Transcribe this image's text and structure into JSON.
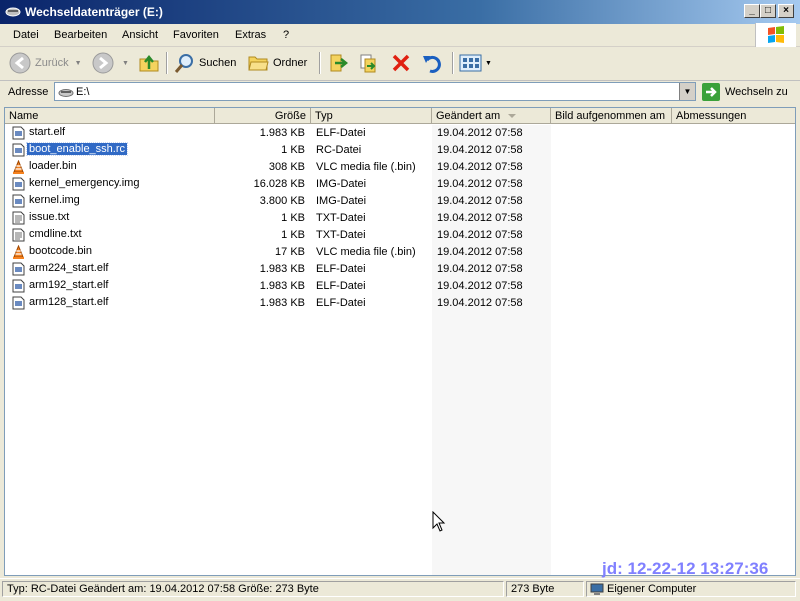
{
  "window": {
    "title": "Wechseldatenträger (E:)"
  },
  "menu": {
    "items": [
      "Datei",
      "Bearbeiten",
      "Ansicht",
      "Favoriten",
      "Extras",
      "?"
    ]
  },
  "toolbar": {
    "back_label": "Zurück",
    "search_label": "Suchen",
    "folders_label": "Ordner"
  },
  "address": {
    "label": "Adresse",
    "value": "E:\\",
    "go_label": "Wechseln zu"
  },
  "list": {
    "columns": [
      "Name",
      "Größe",
      "Typ",
      "Geändert am",
      "Bild aufgenommen am",
      "Abmessungen"
    ],
    "rows": [
      {
        "name": "start.elf",
        "size": "1.983 KB",
        "type": "ELF-Datei",
        "modified": "19.04.2012 07:58",
        "icon": "file-icon"
      },
      {
        "name": "boot_enable_ssh.rc",
        "size": "1 KB",
        "type": "RC-Datei",
        "modified": "19.04.2012 07:58",
        "icon": "file-icon",
        "selected": true
      },
      {
        "name": "loader.bin",
        "size": "308 KB",
        "type": "VLC media file (.bin)",
        "modified": "19.04.2012 07:58",
        "icon": "vlc-icon"
      },
      {
        "name": "kernel_emergency.img",
        "size": "16.028 KB",
        "type": "IMG-Datei",
        "modified": "19.04.2012 07:58",
        "icon": "file-icon"
      },
      {
        "name": "kernel.img",
        "size": "3.800 KB",
        "type": "IMG-Datei",
        "modified": "19.04.2012 07:58",
        "icon": "file-icon"
      },
      {
        "name": "issue.txt",
        "size": "1 KB",
        "type": "TXT-Datei",
        "modified": "19.04.2012 07:58",
        "icon": "text-file-icon"
      },
      {
        "name": "cmdline.txt",
        "size": "1 KB",
        "type": "TXT-Datei",
        "modified": "19.04.2012 07:58",
        "icon": "text-file-icon"
      },
      {
        "name": "bootcode.bin",
        "size": "17 KB",
        "type": "VLC media file (.bin)",
        "modified": "19.04.2012 07:58",
        "icon": "vlc-icon"
      },
      {
        "name": "arm224_start.elf",
        "size": "1.983 KB",
        "type": "ELF-Datei",
        "modified": "19.04.2012 07:58",
        "icon": "file-icon"
      },
      {
        "name": "arm192_start.elf",
        "size": "1.983 KB",
        "type": "ELF-Datei",
        "modified": "19.04.2012 07:58",
        "icon": "file-icon"
      },
      {
        "name": "arm128_start.elf",
        "size": "1.983 KB",
        "type": "ELF-Datei",
        "modified": "19.04.2012 07:58",
        "icon": "file-icon"
      }
    ]
  },
  "watermark": "jd: 12-22-12 13:27:36",
  "status": {
    "info": "Typ: RC-Datei Geändert am: 19.04.2012 07:58 Größe: 273 Byte",
    "size": "273 Byte",
    "zone": "Eigener Computer"
  },
  "colors": {
    "selection": "#316ac5",
    "titlebar": "#0a246a",
    "watermark": "#8080ff"
  }
}
